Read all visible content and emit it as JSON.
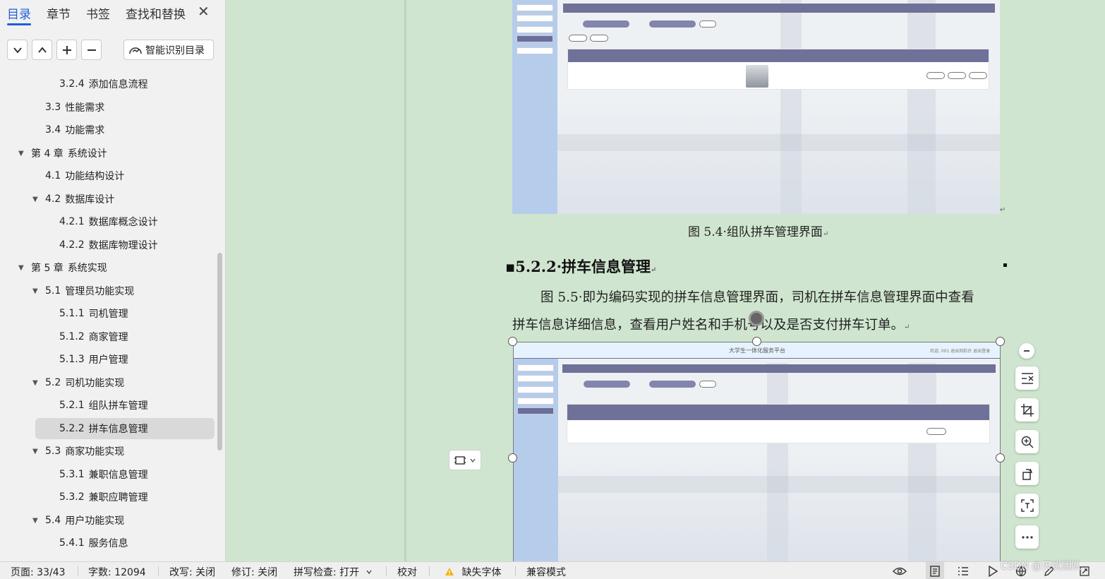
{
  "nav": {
    "tabs": [
      {
        "label": "目录"
      },
      {
        "label": "章节"
      },
      {
        "label": "书签"
      },
      {
        "label": "查找和替换"
      }
    ],
    "smart_button_label": "智能识别目录",
    "toc": [
      {
        "num": "3.2.4",
        "text": "添加信息流程"
      },
      {
        "num": "3.3",
        "text": "性能需求"
      },
      {
        "num": "3.4",
        "text": "功能需求"
      },
      {
        "num": "第 4 章",
        "text": "系统设计"
      },
      {
        "num": "4.1",
        "text": "功能结构设计"
      },
      {
        "num": "4.2",
        "text": "数据库设计"
      },
      {
        "num": "4.2.1",
        "text": "数据库概念设计"
      },
      {
        "num": "4.2.2",
        "text": "数据库物理设计"
      },
      {
        "num": "第 5 章",
        "text": "系统实现"
      },
      {
        "num": "5.1",
        "text": "管理员功能实现"
      },
      {
        "num": "5.1.1",
        "text": "司机管理"
      },
      {
        "num": "5.1.2",
        "text": "商家管理"
      },
      {
        "num": "5.1.3",
        "text": "用户管理"
      },
      {
        "num": "5.2",
        "text": "司机功能实现"
      },
      {
        "num": "5.2.1",
        "text": "组队拼车管理"
      },
      {
        "num": "5.2.2",
        "text": "拼车信息管理"
      },
      {
        "num": "5.3",
        "text": "商家功能实现"
      },
      {
        "num": "5.3.1",
        "text": "兼职信息管理"
      },
      {
        "num": "5.3.2",
        "text": "兼职应聘管理"
      },
      {
        "num": "5.4",
        "text": "用户功能实现"
      },
      {
        "num": "5.4.1",
        "text": "服务信息"
      }
    ]
  },
  "document": {
    "caption_1": "图 5.4·组队拼车管理界面",
    "heading": "▪5.2.2·拼车信息管理",
    "para_line_1": "图 5.5·即为编码实现的拼车信息管理界面，司机在拼车信息管理界面中查看",
    "para_line_2": "拼车信息详细信息，查看用户姓名和手机号以及是否支付拼车订单。",
    "screenshot_2_title": "大学生一体化服务平台",
    "screenshot_2_header_links": "欢迎, 001   退出到前台   退出登录"
  },
  "status": {
    "page": "页面: 33/43",
    "words": "字数: 12094",
    "revise_mode": "改写: 关闭",
    "track_changes": "修订: 关闭",
    "spell_check": "拼写检查: 打开",
    "proofread": "校对",
    "missing_fonts": "缺失字体",
    "compat_mode": "兼容模式"
  },
  "watermark": "CSDN @天忧团队",
  "colors": {
    "accent": "#1f5fd8",
    "doc_background": "#cfe5cf",
    "panel_background": "#f1f1f1",
    "table_header": "#6f7199"
  }
}
